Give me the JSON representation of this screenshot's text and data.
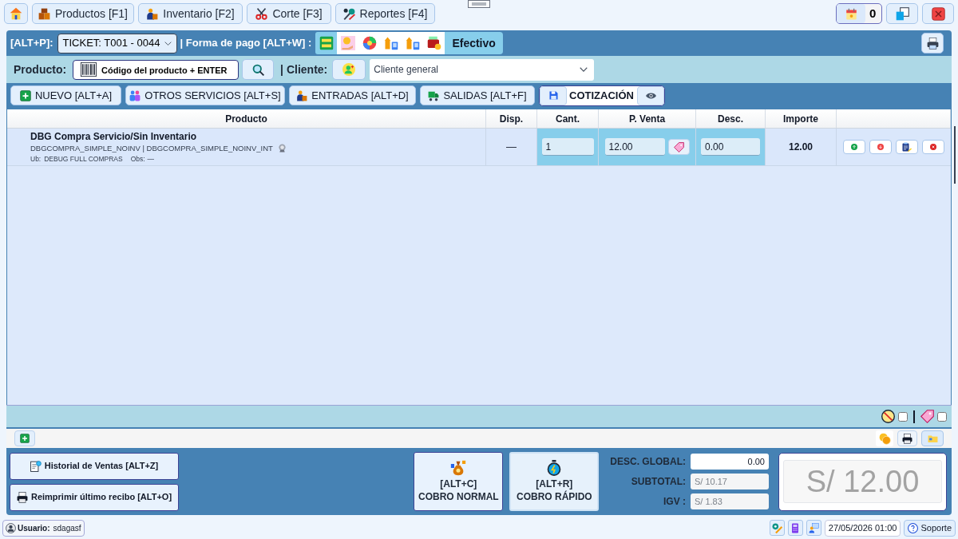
{
  "nav_tabs": [
    {
      "label": "Productos [F1]"
    },
    {
      "label": "Inventario [F2]"
    },
    {
      "label": "Corte [F3]"
    },
    {
      "label": "Reportes [F4]"
    }
  ],
  "notifications": {
    "count": "0"
  },
  "sale_bar": {
    "ticket_shortcut": "[ALT+P]:",
    "ticket": "TICKET: T001 - 0044",
    "payment_label": "| Forma de pago [ALT+W] :",
    "payment_methods": [
      {
        "selected": true
      },
      {
        "selected": false
      },
      {
        "selected": false
      },
      {
        "selected": false
      },
      {
        "selected": false
      },
      {
        "selected": false
      }
    ],
    "payment_name": "Efectivo"
  },
  "search_bar": {
    "product_label": "Producto:",
    "product_input": {
      "placeholder": "Código del producto + ENTER"
    },
    "client_label": "| Cliente:",
    "client_select": {
      "value": "Cliente general"
    }
  },
  "actions": [
    {
      "label": "NUEVO [ALT+A]"
    },
    {
      "label": "OTROS SERVICIOS [ALT+S]"
    },
    {
      "label": "ENTRADAS [ALT+D]"
    },
    {
      "label": "SALIDAS [ALT+F]"
    }
  ],
  "quote": {
    "label": "COTIZACIÓN"
  },
  "table": {
    "columns": [
      "Producto",
      "Disp.",
      "Cant.",
      "P. Venta",
      "Desc.",
      "Importe"
    ],
    "rows": [
      {
        "name": "DBG Compra Servicio/Sin Inventario",
        "codes": "DBGCOMPRA_SIMPLE_NOINV | DBGCOMPRA_SIMPLE_NOINV_INT",
        "location_label": "Ub:",
        "location": "DEBUG FULL COMPRAS",
        "obs_label": "Obs:",
        "obs": "—",
        "disp": "—",
        "quantity": "1",
        "price": "12.00",
        "discount": "0.00",
        "amount": "12.00"
      }
    ]
  },
  "toggles": [
    {
      "checked": false
    },
    {
      "checked": false
    }
  ],
  "side_buttons": [
    "Historial de Ventas [ALT+Z]",
    "Reimprimir último recibo [ALT+O]"
  ],
  "charge_buttons": [
    {
      "shortcut": "[ALT+C]",
      "label": "COBRO NORMAL",
      "focused": true
    },
    {
      "shortcut": "[ALT+R]",
      "label": "COBRO RÁPIDO",
      "focused": false
    }
  ],
  "totals": [
    {
      "label": "DESC. GLOBAL:",
      "value": "0.00",
      "kind": "input"
    },
    {
      "label": "SUBTOTAL:",
      "value": "S/ 10.17",
      "kind": "readonly"
    },
    {
      "label": "IGV :",
      "value": "S/ 1.83",
      "kind": "readonly"
    }
  ],
  "total": "S/ 12.00",
  "status_bar": {
    "user_label": "Usuario:",
    "user": "sdagasf",
    "datetime": "27/05/2026 01:00",
    "support": "Soporte"
  }
}
